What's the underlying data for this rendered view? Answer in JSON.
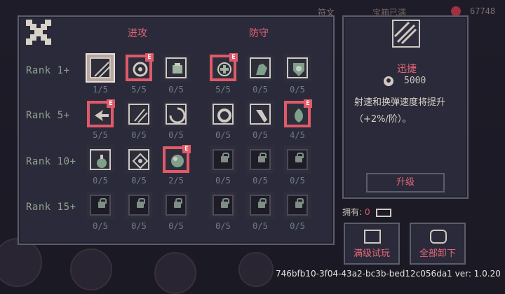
{
  "topbar": {
    "left_text": "符文",
    "mid_text": "宝箱已满",
    "coins": "67748"
  },
  "headers": {
    "attack": "进攻",
    "defense": "防守"
  },
  "ranks": [
    "Rank 1+",
    "Rank 5+",
    "Rank 10+",
    "Rank 15+"
  ],
  "grid": [
    [
      {
        "count": "1/5",
        "icon": "stripes-icon",
        "state": "selected"
      },
      {
        "count": "5/5",
        "icon": "swirl-icon",
        "state": "equipped"
      },
      {
        "count": "0/5",
        "icon": "fist-icon",
        "state": "normal"
      },
      {
        "count": "5/5",
        "icon": "heal-icon",
        "state": "equipped"
      },
      {
        "count": "0/5",
        "icon": "muscle-icon",
        "state": "normal"
      },
      {
        "count": "0/5",
        "icon": "shield-eye-icon",
        "state": "normal"
      }
    ],
    [
      {
        "count": "5/5",
        "icon": "arrow-icon",
        "state": "equipped"
      },
      {
        "count": "0/5",
        "icon": "claw-icon",
        "state": "normal"
      },
      {
        "count": "0/5",
        "icon": "vortex-icon",
        "state": "normal"
      },
      {
        "count": "0/5",
        "icon": "ring-icon",
        "state": "normal"
      },
      {
        "count": "0/5",
        "icon": "leg-icon",
        "state": "normal"
      },
      {
        "count": "4/5",
        "icon": "leaf-icon",
        "state": "equipped"
      }
    ],
    [
      {
        "count": "0/5",
        "icon": "potion-icon",
        "state": "normal"
      },
      {
        "count": "0/5",
        "icon": "diamond-icon",
        "state": "normal"
      },
      {
        "count": "2/5",
        "icon": "orb-icon",
        "state": "equipped"
      },
      {
        "count": "0/5",
        "icon": "lock-icon",
        "state": "locked"
      },
      {
        "count": "0/5",
        "icon": "lock-icon",
        "state": "locked"
      },
      {
        "count": "0/5",
        "icon": "lock-icon",
        "state": "locked"
      }
    ],
    [
      {
        "count": "0/5",
        "icon": "lock-icon",
        "state": "locked"
      },
      {
        "count": "0/5",
        "icon": "lock-icon",
        "state": "locked"
      },
      {
        "count": "0/5",
        "icon": "lock-icon",
        "state": "locked"
      },
      {
        "count": "0/5",
        "icon": "lock-icon",
        "state": "locked"
      },
      {
        "count": "0/5",
        "icon": "lock-icon",
        "state": "locked"
      },
      {
        "count": "0/5",
        "icon": "lock-icon",
        "state": "locked"
      }
    ]
  ],
  "badge_text": "E",
  "side": {
    "title": "迅捷",
    "cost": "5000",
    "description": "射速和换弹速度将提升（+2%/阶）。",
    "upgrade_label": "升级"
  },
  "own": {
    "label": "拥有:",
    "value": "0"
  },
  "buttons": {
    "trial_label": "满级试玩",
    "unequip_label": "全部卸下"
  },
  "footer_id": "746bfb10-3f04-43a2-bc3b-bed12c056da1 ver: 1.0.20",
  "colors": {
    "accent": "#e05a6a",
    "panel": "#2b2a3a",
    "text_green": "#8ea48f"
  }
}
